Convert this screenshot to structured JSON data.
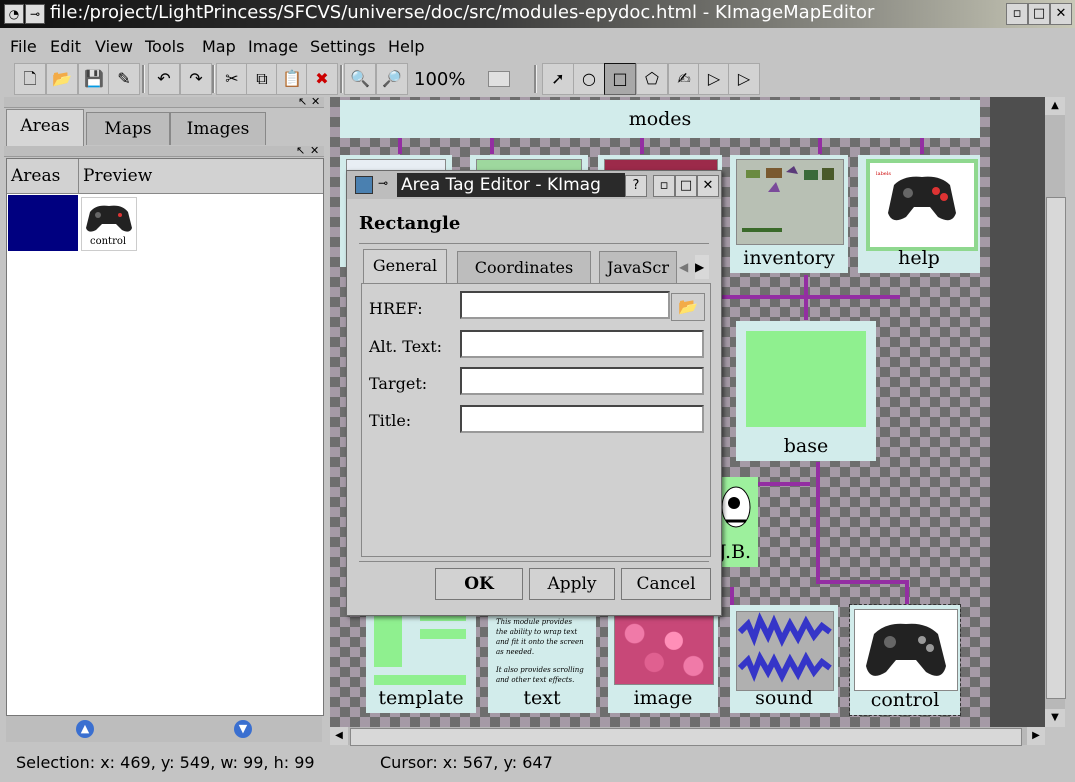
{
  "window": {
    "title": "file:/project/LightPrincess/SFCVS/universe/doc/src/modules-epydoc.html - KImageMapEditor",
    "controls": {
      "minimize": "▫",
      "maximize": "□",
      "close": "✕"
    }
  },
  "menu": {
    "file": "File",
    "edit": "Edit",
    "view": "View",
    "tools": "Tools",
    "map": "Map",
    "image": "Image",
    "settings": "Settings",
    "help": "Help"
  },
  "toolbar": {
    "zoom": "100%"
  },
  "left_panel": {
    "tabs": [
      "Areas",
      "Maps",
      "Images"
    ],
    "columns": [
      "Areas",
      "Preview"
    ],
    "rows": [
      {
        "preview_label": "control",
        "swatch_color": "#000080"
      }
    ],
    "icons": {
      "undock": "↖",
      "close": "✕"
    }
  },
  "canvas": {
    "nodes": {
      "modes": "modes",
      "inventory": "inventory",
      "help": "help",
      "base": "base",
      "jb": "J.B.",
      "template": "template",
      "text": "text",
      "image": "image",
      "sound": "sound",
      "control": "control"
    },
    "text_module": {
      "line1": "This module provides",
      "line2": "the ability to wrap text",
      "line3": "and fit it onto the screen",
      "line4": "as needed.",
      "line5": "It also provides scrolling",
      "line6": "and other text effects."
    }
  },
  "dialog": {
    "title": "Area Tag Editor - KImag",
    "shape": "Rectangle",
    "tabs": [
      "General",
      "Coordinates",
      "JavaScr"
    ],
    "fields": {
      "href_label": "HREF:",
      "alt_label": "Alt. Text:",
      "target_label": "Target:",
      "title_label": "Title:",
      "href_value": "",
      "alt_value": "",
      "target_value": "",
      "title_value": ""
    },
    "buttons": {
      "ok": "OK",
      "apply": "Apply",
      "cancel": "Cancel"
    }
  },
  "status": {
    "selection": "Selection: x: 469, y: 549, w: 99, h: 99",
    "cursor": "Cursor: x: 567, y: 647"
  }
}
